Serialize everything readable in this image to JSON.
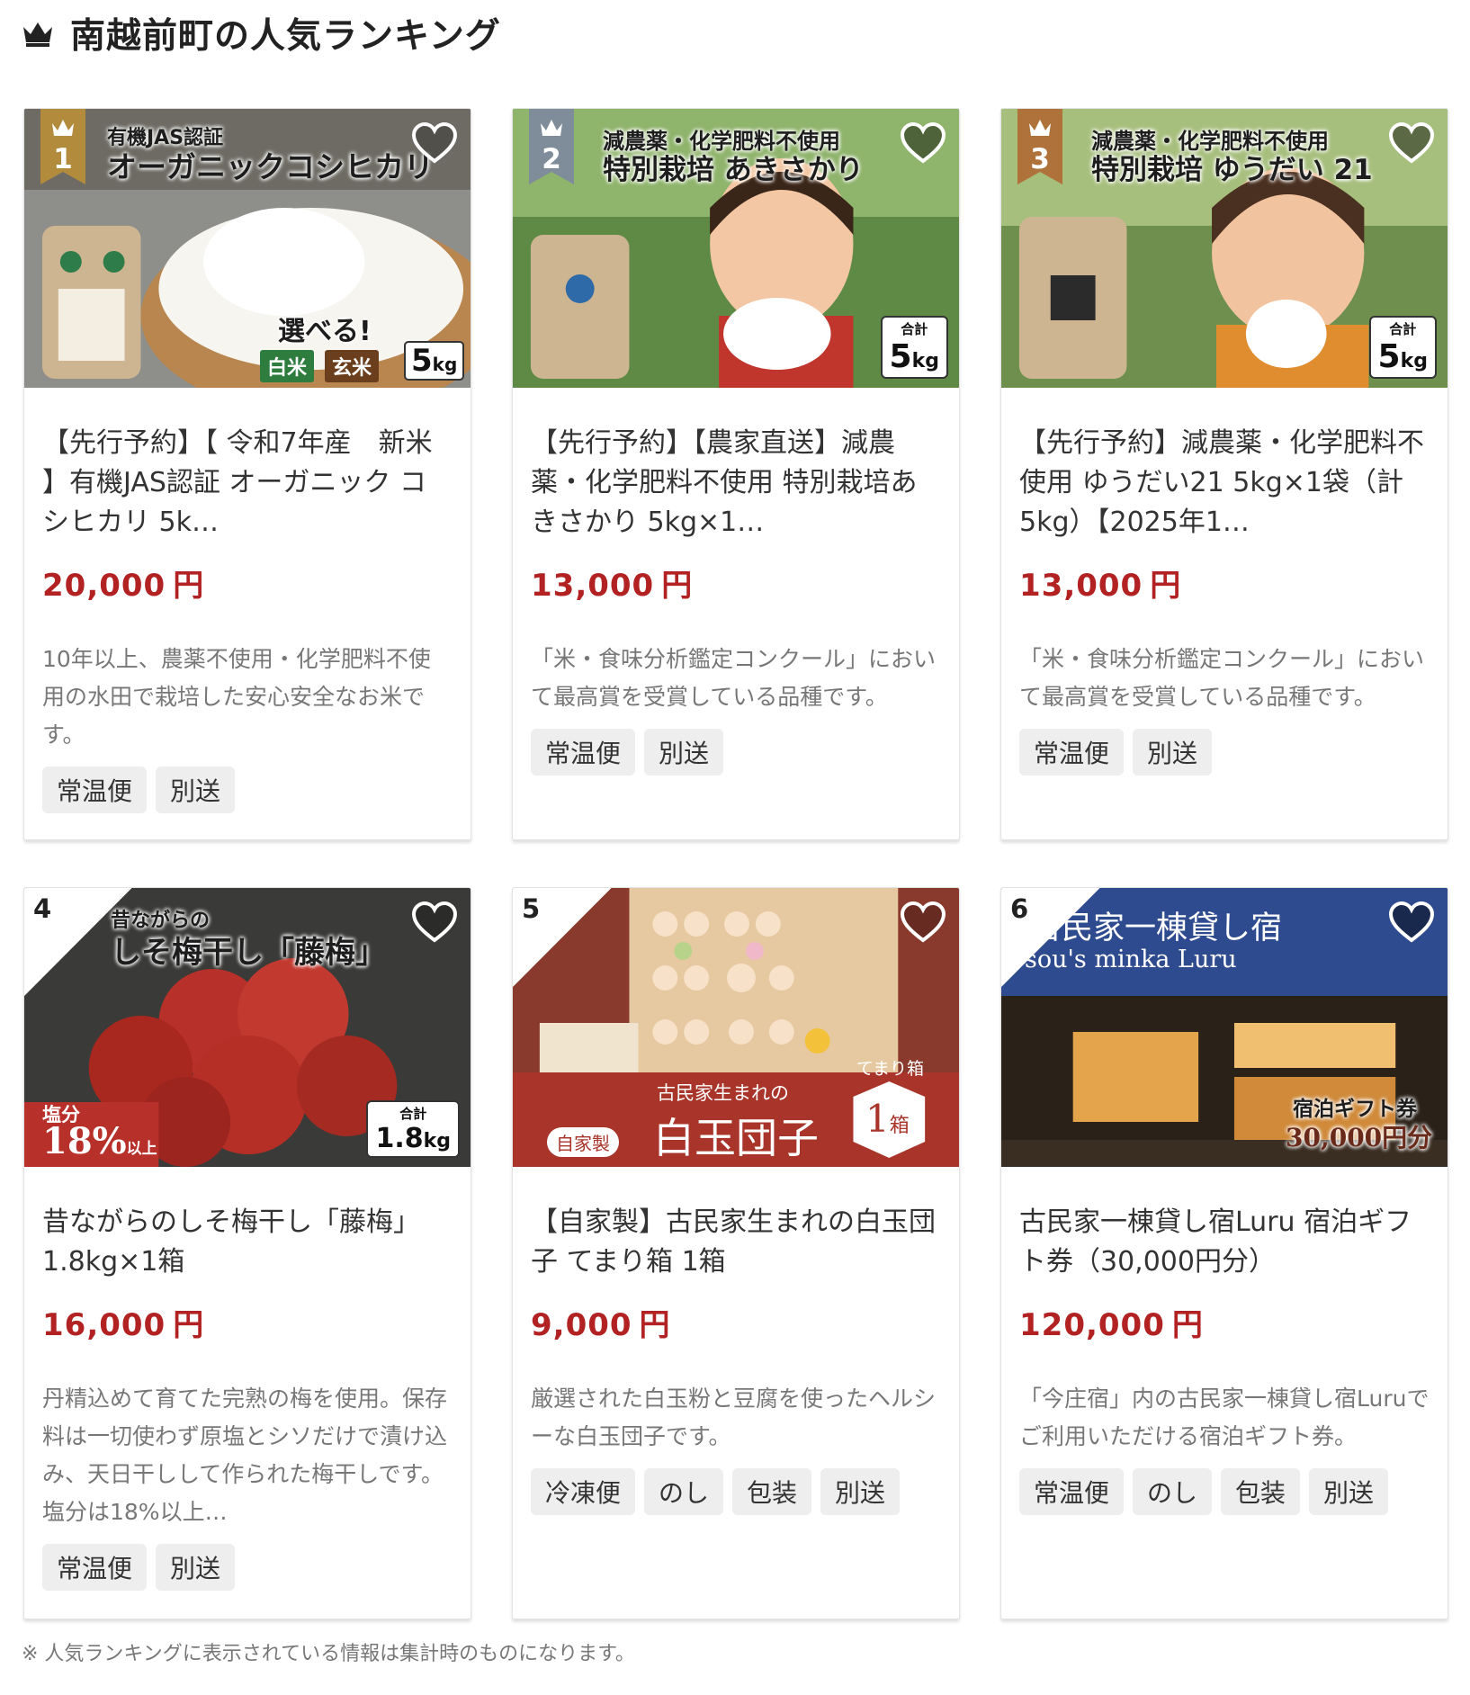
{
  "heading": {
    "title": "南越前町の人気ランキング",
    "icon": "crown-icon"
  },
  "colors": {
    "price": "#b22222",
    "gold": "#b38b3c",
    "silver": "#7f8c9a",
    "bronze": "#b0723b"
  },
  "products": [
    {
      "rank": "1",
      "image_text": {
        "line1": "有機JAS認証",
        "line2": "オーガニックコシヒカリ",
        "line3": "選べる!",
        "chip1": "白米",
        "chip2": "玄米",
        "kg": "5",
        "kg_unit": "kg"
      },
      "title": "【先行予約】【 令和7年産　新米 】有機JAS認証 オーガニック コシヒカリ 5k…",
      "price": "20,000",
      "yen": "円",
      "description": "10年以上、農薬不使用・化学肥料不使用の水田で栽培した安心安全なお米です。",
      "tags": [
        "常温便",
        "別送"
      ]
    },
    {
      "rank": "2",
      "image_text": {
        "line1": "減農薬・化学肥料不使用",
        "line2": "特別栽培 あきさかり",
        "total": "合計",
        "kg": "5",
        "kg_unit": "kg"
      },
      "title": "【先行予約】【農家直送】減農薬・化学肥料不使用 特別栽培あきさかり 5kg×1…",
      "price": "13,000",
      "yen": "円",
      "description": "「米・食味分析鑑定コンクール」において最高賞を受賞している品種です。",
      "tags": [
        "常温便",
        "別送"
      ]
    },
    {
      "rank": "3",
      "image_text": {
        "line1": "減農薬・化学肥料不使用",
        "line2": "特別栽培 ゆうだい 21",
        "total": "合計",
        "kg": "5",
        "kg_unit": "kg"
      },
      "title": "【先行予約】減農薬・化学肥料不使用 ゆうだい21 5kg×1袋（計5kg）【2025年1…",
      "price": "13,000",
      "yen": "円",
      "description": "「米・食味分析鑑定コンクール」において最高賞を受賞している品種です。",
      "tags": [
        "常温便",
        "別送"
      ]
    },
    {
      "rank": "4",
      "image_text": {
        "line1": "昔ながらの",
        "line2": "しそ梅干し「藤梅」",
        "salt1": "塩分",
        "salt2": "18%",
        "salt3": "以上",
        "total": "合計",
        "kg": "1.8",
        "kg_unit": "kg"
      },
      "title": "昔ながらのしそ梅干し「藤梅」1.8kg×1箱",
      "price": "16,000",
      "yen": "円",
      "description": "丹精込めて育てた完熟の梅を使用。保存料は一切使わず原塩とシソだけで漬け込み、天日干しして作られた梅干しです。塩分は18%以上…",
      "tags": [
        "常温便",
        "別送"
      ]
    },
    {
      "rank": "5",
      "image_text": {
        "line1": "古民家生まれの",
        "line2": "白玉団子",
        "made": "自家製",
        "box": "てまり箱",
        "count": "1",
        "count_unit": "箱"
      },
      "title": "【自家製】古民家生まれの白玉団子 てまり箱 1箱",
      "price": "9,000",
      "yen": "円",
      "description": "厳選された白玉粉と豆腐を使ったヘルシーな白玉団子です。",
      "tags": [
        "冷凍便",
        "のし",
        "包装",
        "別送"
      ]
    },
    {
      "rank": "6",
      "image_text": {
        "line1": "古民家一棟貸し宿",
        "line2": "sou's minka Luru",
        "gift": "宿泊ギフト券",
        "amount": "30,000円分"
      },
      "title": "古民家一棟貸し宿Luru 宿泊ギフト券（30,000円分）",
      "price": "120,000",
      "yen": "円",
      "description": "「今庄宿」内の古民家一棟貸し宿Luruでご利用いただける宿泊ギフト券。",
      "tags": [
        "常温便",
        "のし",
        "包装",
        "別送"
      ]
    }
  ],
  "footer_note": "※ 人気ランキングに表示されている情報は集計時のものになります。"
}
